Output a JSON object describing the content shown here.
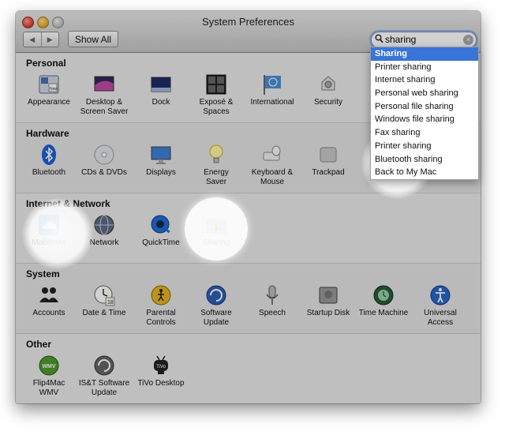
{
  "window": {
    "title": "System Preferences"
  },
  "toolbar": {
    "back_label": "◀",
    "forward_label": "▶",
    "show_all_label": "Show All"
  },
  "search": {
    "value": "sharing",
    "clear_glyph": "×"
  },
  "sections": [
    {
      "title": "Personal",
      "items": [
        {
          "label": "Appearance",
          "icon": "appearance-icon"
        },
        {
          "label": "Desktop &\nScreen Saver",
          "icon": "desktop-icon"
        },
        {
          "label": "Dock",
          "icon": "dock-icon"
        },
        {
          "label": "Exposé &\nSpaces",
          "icon": "expose-icon"
        },
        {
          "label": "International",
          "icon": "flag-icon"
        },
        {
          "label": "Security",
          "icon": "security-icon"
        }
      ]
    },
    {
      "title": "Hardware",
      "items": [
        {
          "label": "Bluetooth",
          "icon": "bluetooth-icon"
        },
        {
          "label": "CDs & DVDs",
          "icon": "cd-icon"
        },
        {
          "label": "Displays",
          "icon": "display-icon"
        },
        {
          "label": "Energy\nSaver",
          "icon": "bulb-icon"
        },
        {
          "label": "Keyboard &\nMouse",
          "icon": "keyboard-icon"
        },
        {
          "label": "Trackpad",
          "icon": "trackpad-icon"
        }
      ]
    },
    {
      "title": "Internet & Network",
      "items": [
        {
          "label": "MobileMe",
          "icon": "cloud-icon"
        },
        {
          "label": "Network",
          "icon": "network-icon"
        },
        {
          "label": "QuickTime",
          "icon": "quicktime-icon"
        },
        {
          "label": "Sharing",
          "icon": "sharing-icon"
        }
      ]
    },
    {
      "title": "System",
      "items": [
        {
          "label": "Accounts",
          "icon": "accounts-icon"
        },
        {
          "label": "Date & Time",
          "icon": "clock-icon"
        },
        {
          "label": "Parental\nControls",
          "icon": "parental-icon"
        },
        {
          "label": "Software\nUpdate",
          "icon": "update-icon"
        },
        {
          "label": "Speech",
          "icon": "mic-icon"
        },
        {
          "label": "Startup Disk",
          "icon": "disk-icon"
        },
        {
          "label": "Time Machine",
          "icon": "timemachine-icon"
        },
        {
          "label": "Universal\nAccess",
          "icon": "accessibility-icon"
        }
      ]
    },
    {
      "title": "Other",
      "items": [
        {
          "label": "Flip4Mac\nWMV",
          "icon": "wmv-icon",
          "badge": "WMV"
        },
        {
          "label": "IS&T Software\nUpdate",
          "icon": "ist-update-icon"
        },
        {
          "label": "TiVo Desktop",
          "icon": "tivo-icon"
        }
      ]
    }
  ],
  "suggestions": [
    "Sharing",
    "Printer sharing",
    "Internet sharing",
    "Personal web sharing",
    "Personal file sharing",
    "Windows file sharing",
    "Fax sharing",
    "Printer sharing",
    "Bluetooth sharing",
    "Back to My Mac"
  ]
}
